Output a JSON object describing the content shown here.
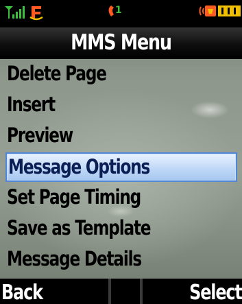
{
  "status_bar": {
    "signal_icon": "signal-strength-icon",
    "network_icon": "network-type-icon",
    "line_indicator": "1",
    "battery_icon": "battery-icon"
  },
  "title": "MMS Menu",
  "menu": {
    "items": [
      {
        "label": "Delete Page",
        "selected": false
      },
      {
        "label": "Insert",
        "selected": false
      },
      {
        "label": "Preview",
        "selected": false
      },
      {
        "label": "Message Options",
        "selected": true
      },
      {
        "label": "Set Page Timing",
        "selected": false
      },
      {
        "label": "Save as Template",
        "selected": false
      },
      {
        "label": "Message Details",
        "selected": false
      }
    ]
  },
  "softkeys": {
    "left": "Back",
    "right": "Select"
  },
  "colors": {
    "status_signal": "#3fbf3f",
    "line_indicator": "#ff5a1f",
    "battery": "#f0c000",
    "highlight": "#bcd6f6",
    "highlight_border": "#4f86d6"
  }
}
